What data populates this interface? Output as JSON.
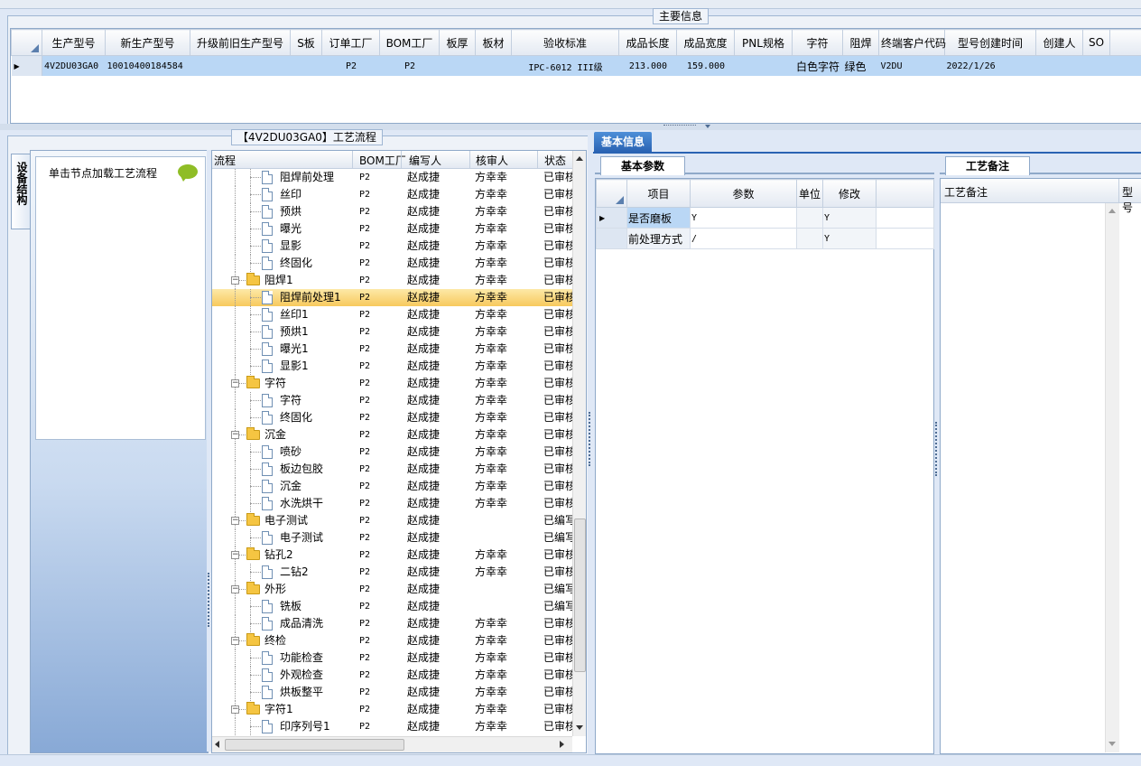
{
  "main_info": {
    "title": "主要信息",
    "columns": [
      "生产型号",
      "新生产型号",
      "升级前旧生产型号",
      "S板",
      "订单工厂",
      "BOM工厂",
      "板厚",
      "板材",
      "验收标准",
      "成品长度",
      "成品宽度",
      "PNL规格",
      "字符",
      "阻焊",
      "终端客户代码",
      "型号创建时间",
      "创建人",
      "SO"
    ],
    "row": [
      "4V2DU03GA0",
      "10010400184584",
      "",
      "",
      "P2",
      "P2",
      "",
      "",
      "IPC-6012 III级",
      "213.000",
      "159.000",
      "",
      "白色字符",
      "绿色",
      "V2DU",
      "2022/1/26",
      "",
      ""
    ]
  },
  "side_tab": {
    "label": "设备结构"
  },
  "hint": {
    "text": "单击节点加载工艺流程"
  },
  "process": {
    "title": "【4V2DU03GA0】工艺流程",
    "columns": [
      "流程",
      "BOM工厂",
      "编写人",
      "核审人",
      "状态"
    ],
    "rows": [
      {
        "kind": "leaf",
        "name": "阻焊前处理",
        "bom": "P2",
        "writer": "赵成捷",
        "reviewer": "方幸幸",
        "status": "已审核"
      },
      {
        "kind": "leaf",
        "name": "丝印",
        "bom": "P2",
        "writer": "赵成捷",
        "reviewer": "方幸幸",
        "status": "已审核"
      },
      {
        "kind": "leaf",
        "name": "预烘",
        "bom": "P2",
        "writer": "赵成捷",
        "reviewer": "方幸幸",
        "status": "已审核"
      },
      {
        "kind": "leaf",
        "name": "曝光",
        "bom": "P2",
        "writer": "赵成捷",
        "reviewer": "方幸幸",
        "status": "已审核"
      },
      {
        "kind": "leaf",
        "name": "显影",
        "bom": "P2",
        "writer": "赵成捷",
        "reviewer": "方幸幸",
        "status": "已审核"
      },
      {
        "kind": "leaf",
        "name": "终固化",
        "bom": "P2",
        "writer": "赵成捷",
        "reviewer": "方幸幸",
        "status": "已审核"
      },
      {
        "kind": "folder",
        "name": "阻焊1",
        "bom": "P2",
        "writer": "赵成捷",
        "reviewer": "方幸幸",
        "status": "已审核"
      },
      {
        "kind": "leaf",
        "name": "阻焊前处理1",
        "bom": "P2",
        "writer": "赵成捷",
        "reviewer": "方幸幸",
        "status": "已审核",
        "selected": true
      },
      {
        "kind": "leaf",
        "name": "丝印1",
        "bom": "P2",
        "writer": "赵成捷",
        "reviewer": "方幸幸",
        "status": "已审核"
      },
      {
        "kind": "leaf",
        "name": "预烘1",
        "bom": "P2",
        "writer": "赵成捷",
        "reviewer": "方幸幸",
        "status": "已审核"
      },
      {
        "kind": "leaf",
        "name": "曝光1",
        "bom": "P2",
        "writer": "赵成捷",
        "reviewer": "方幸幸",
        "status": "已审核"
      },
      {
        "kind": "leaf",
        "name": "显影1",
        "bom": "P2",
        "writer": "赵成捷",
        "reviewer": "方幸幸",
        "status": "已审核"
      },
      {
        "kind": "folder",
        "name": "字符",
        "bom": "P2",
        "writer": "赵成捷",
        "reviewer": "方幸幸",
        "status": "已审核"
      },
      {
        "kind": "leaf",
        "name": "字符",
        "bom": "P2",
        "writer": "赵成捷",
        "reviewer": "方幸幸",
        "status": "已审核"
      },
      {
        "kind": "leaf",
        "name": "终固化",
        "bom": "P2",
        "writer": "赵成捷",
        "reviewer": "方幸幸",
        "status": "已审核"
      },
      {
        "kind": "folder",
        "name": "沉金",
        "bom": "P2",
        "writer": "赵成捷",
        "reviewer": "方幸幸",
        "status": "已审核"
      },
      {
        "kind": "leaf",
        "name": "喷砂",
        "bom": "P2",
        "writer": "赵成捷",
        "reviewer": "方幸幸",
        "status": "已审核"
      },
      {
        "kind": "leaf",
        "name": "板边包胶",
        "bom": "P2",
        "writer": "赵成捷",
        "reviewer": "方幸幸",
        "status": "已审核"
      },
      {
        "kind": "leaf",
        "name": "沉金",
        "bom": "P2",
        "writer": "赵成捷",
        "reviewer": "方幸幸",
        "status": "已审核"
      },
      {
        "kind": "leaf",
        "name": "水洗烘干",
        "bom": "P2",
        "writer": "赵成捷",
        "reviewer": "方幸幸",
        "status": "已审核"
      },
      {
        "kind": "folder",
        "name": "电子测试",
        "bom": "P2",
        "writer": "赵成捷",
        "reviewer": "",
        "status": "已编写"
      },
      {
        "kind": "leaf",
        "name": "电子测试",
        "bom": "P2",
        "writer": "赵成捷",
        "reviewer": "",
        "status": "已编写"
      },
      {
        "kind": "folder",
        "name": "钻孔2",
        "bom": "P2",
        "writer": "赵成捷",
        "reviewer": "方幸幸",
        "status": "已审核"
      },
      {
        "kind": "leaf",
        "name": "二钻2",
        "bom": "P2",
        "writer": "赵成捷",
        "reviewer": "方幸幸",
        "status": "已审核"
      },
      {
        "kind": "folder",
        "name": "外形",
        "bom": "P2",
        "writer": "赵成捷",
        "reviewer": "",
        "status": "已编写"
      },
      {
        "kind": "leaf",
        "name": "铣板",
        "bom": "P2",
        "writer": "赵成捷",
        "reviewer": "",
        "status": "已编写"
      },
      {
        "kind": "leaf",
        "name": "成品清洗",
        "bom": "P2",
        "writer": "赵成捷",
        "reviewer": "方幸幸",
        "status": "已审核"
      },
      {
        "kind": "folder",
        "name": "终检",
        "bom": "P2",
        "writer": "赵成捷",
        "reviewer": "方幸幸",
        "status": "已审核"
      },
      {
        "kind": "leaf",
        "name": "功能检查",
        "bom": "P2",
        "writer": "赵成捷",
        "reviewer": "方幸幸",
        "status": "已审核"
      },
      {
        "kind": "leaf",
        "name": "外观检查",
        "bom": "P2",
        "writer": "赵成捷",
        "reviewer": "方幸幸",
        "status": "已审核"
      },
      {
        "kind": "leaf",
        "name": "烘板整平",
        "bom": "P2",
        "writer": "赵成捷",
        "reviewer": "方幸幸",
        "status": "已审核"
      },
      {
        "kind": "folder",
        "name": "字符1",
        "bom": "P2",
        "writer": "赵成捷",
        "reviewer": "方幸幸",
        "status": "已审核"
      },
      {
        "kind": "leaf",
        "name": "印序列号1",
        "bom": "P2",
        "writer": "赵成捷",
        "reviewer": "方幸幸",
        "status": "已审核"
      }
    ]
  },
  "basic_info": {
    "tab_label": "基本信息",
    "params_tab": "基本参数",
    "columns": [
      "项目",
      "参数",
      "单位",
      "修改"
    ],
    "rows": [
      {
        "item": "是否磨板",
        "param": "Y",
        "unit": "",
        "modify": "Y"
      },
      {
        "item": "前处理方式",
        "param": "/",
        "unit": "",
        "modify": "Y"
      }
    ]
  },
  "notes": {
    "tab_label": "工艺备注",
    "columns": [
      "工艺备注",
      "型号"
    ]
  }
}
